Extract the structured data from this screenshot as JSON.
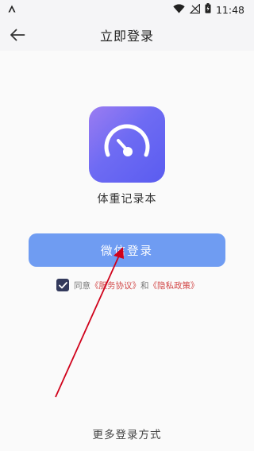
{
  "status_bar": {
    "time": "11:48",
    "icons": [
      "notification-a-icon",
      "wifi-icon",
      "signal-no-sim-icon",
      "battery-charging-icon"
    ]
  },
  "header": {
    "title": "立即登录",
    "back_icon": "arrow-left-icon"
  },
  "app": {
    "name": "体重记录本",
    "icon": "gauge-icon",
    "icon_gradient": [
      "#9b7cf2",
      "#5a5cf0"
    ]
  },
  "login": {
    "wechat_button_label": "微信登录",
    "button_color": "#6f9cf2"
  },
  "agreement": {
    "checked": true,
    "prefix": "同意",
    "service_link": "《服务协议》",
    "conjunction": "和",
    "privacy_link": "《隐私政策》",
    "link_color": "#d24848"
  },
  "more_login_label": "更多登录方式",
  "annotation": {
    "type": "arrow",
    "color": "#d0021b"
  }
}
